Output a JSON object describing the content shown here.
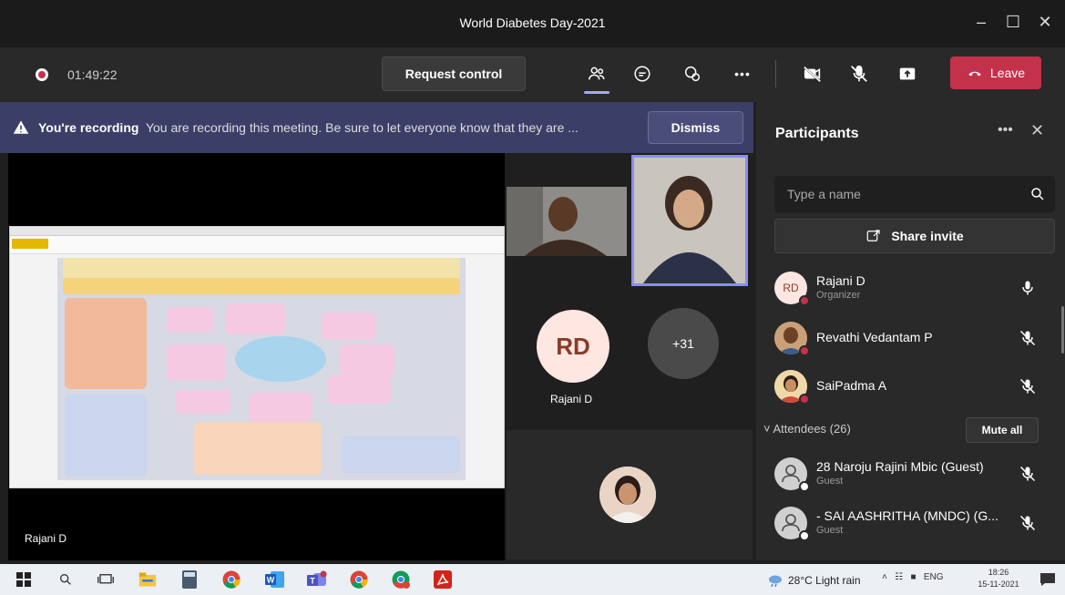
{
  "window": {
    "title": "World Diabetes Day-2021"
  },
  "toolbar": {
    "timer": "01:49:22",
    "request_control_label": "Request control",
    "more_label": "•••",
    "leave_label": "Leave"
  },
  "banner": {
    "bold": "You're recording",
    "text": "You are recording this meeting. Be sure to let everyone know that they are ...",
    "dismiss_label": "Dismiss"
  },
  "stage": {
    "presenter_label": "Rajani D"
  },
  "tiles": {
    "rd_initials": "RD",
    "rd_name": "Rajani D",
    "overflow_count": "+31"
  },
  "participants": {
    "title": "Participants",
    "more": "•••",
    "search_placeholder": "Type a name",
    "share_invite_label": "Share invite",
    "organizers": [
      {
        "initials": "RD",
        "name": "Rajani D",
        "role": "Organizer"
      },
      {
        "name": "Revathi Vedantam P"
      },
      {
        "name": "SaiPadma A"
      }
    ],
    "attendees_label": "Attendees (26)",
    "mute_all_label": "Mute all",
    "attendees": [
      {
        "name": "28 Naroju Rajini Mbic (Guest)",
        "role": "Guest"
      },
      {
        "name": "- SAI AASHRITHA (MNDC) (G...",
        "role": "Guest"
      }
    ]
  },
  "taskbar": {
    "weather": "28°C  Light rain",
    "lang": "ENG",
    "time": "18:26",
    "date": "15-11-2021"
  },
  "colors": {
    "accent": "#a5a8f0",
    "leave": "#c4314b",
    "banner": "#3b3e66"
  }
}
